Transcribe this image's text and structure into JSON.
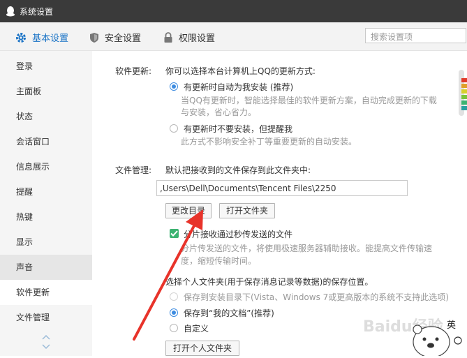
{
  "window": {
    "title": "系统设置"
  },
  "tabs": [
    {
      "label": "基本设置",
      "icon": "gear-icon",
      "active": true
    },
    {
      "label": "安全设置",
      "icon": "shield-icon",
      "active": false
    },
    {
      "label": "权限设置",
      "icon": "lock-icon",
      "active": false
    }
  ],
  "search": {
    "placeholder": "搜索设置项"
  },
  "sidebar": {
    "items": [
      {
        "label": "登录"
      },
      {
        "label": "主面板"
      },
      {
        "label": "状态"
      },
      {
        "label": "会话窗口"
      },
      {
        "label": "信息展示"
      },
      {
        "label": "提醒"
      },
      {
        "label": "热键"
      },
      {
        "label": "显示"
      },
      {
        "label": "声音"
      },
      {
        "label": "软件更新"
      },
      {
        "label": "文件管理"
      }
    ],
    "selected": "软件更新"
  },
  "software_update": {
    "section_label": "软件更新:",
    "description": "你可以选择本台计算机上QQ的更新方式:",
    "option_auto": {
      "label": "有更新时自动为我安装 (推荐)",
      "hint_line1": "当QQ有更新时，智能选择最佳的软件更新方案，自动完成更新的下载",
      "hint_line2": "与安装，省心省力。",
      "checked": true
    },
    "option_remind": {
      "label": "有更新时不要安装，但提醒我",
      "hint": "此方式不影响安全补丁等重要更新的自动安装。",
      "checked": false
    }
  },
  "file_management": {
    "section_label": "文件管理:",
    "description": "默认把接收到的文件保存到此文件夹中:",
    "path_value": ",Users\\Dell\\Documents\\Tencent Files\\2250",
    "change_dir_button": "更改目录",
    "open_folder_button": "打开文件夹",
    "segment_checkbox": {
      "label": "分片接收通过秒传发送的文件",
      "hint_line1": "分片传发送的文件，将使用极速服务器辅助接收。能提高文件传输速",
      "hint_line2": "度，缩短传输时间。",
      "checked": true
    },
    "personal_folder_title": "选择个人文件夹(用于保存消息记录等数据)的保存位置。",
    "personal_options": [
      {
        "label": "保存到安装目录下(Vista、Windows 7或更高版本的系统不支持此选项)",
        "disabled": true,
        "checked": false
      },
      {
        "label": "保存到“我的文档”(推荐)",
        "disabled": false,
        "checked": true
      },
      {
        "label": "自定义",
        "disabled": false,
        "checked": false
      }
    ],
    "open_personal_button": "打开个人文件夹"
  },
  "overlay": {
    "watermark": "Baidu经验",
    "ime_label": "英"
  },
  "colors": {
    "accent": "#1a73c6",
    "radio": "#3c8be0",
    "checkbox": "#3cb371",
    "arrow": "#e8332a",
    "titlebar": "#3a3a3a"
  }
}
